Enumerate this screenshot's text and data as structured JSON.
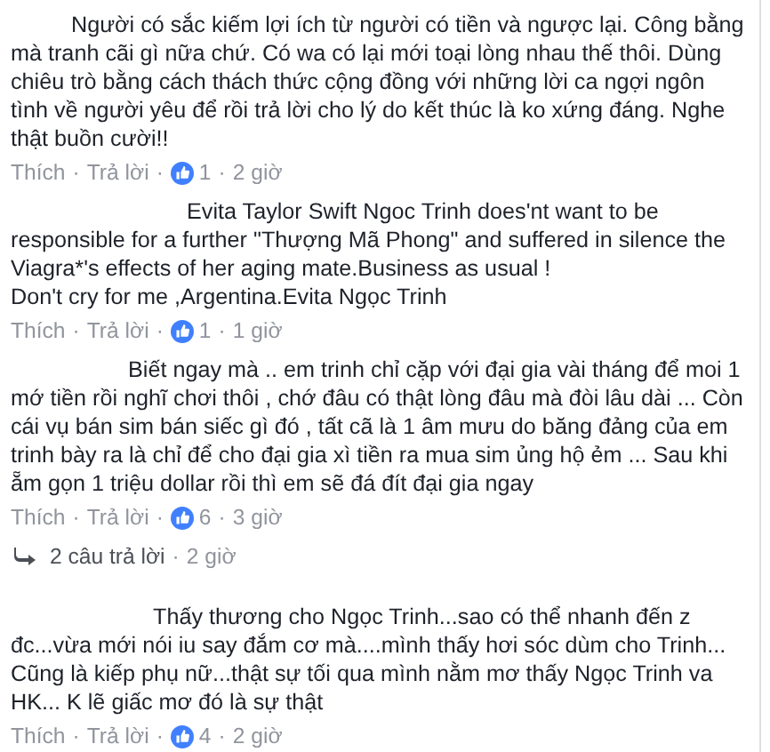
{
  "items": [
    {
      "kind": "comment",
      "text_lines": [
        "Người có sắc kiếm lợi ích từ người có tiền và ngược lại. Công bằng",
        "mà tranh cãi gì nữa chứ. Có wa có lại mới toại lòng nhau thế thôi. Dùng",
        "chiêu trò bằng cách thách thức cộng đồng với những lời ca ngợi ngôn",
        "tình về người yêu để rồi trả lời cho lý do kết thúc là ko xứng đáng. Nghe",
        "thật buồn cười!!"
      ],
      "like_label": "Thích",
      "reply_label": "Trả lời",
      "reactions": "1",
      "time": "2 giờ",
      "separators": [
        "·",
        "·",
        "·"
      ]
    },
    {
      "kind": "comment",
      "text_lines": [
        "Evita Taylor Swift Ngoc Trinh does'nt want to be",
        "responsible for a further \"Thượng Mã Phong\" and suffered in silence the",
        "Viagra*'s effects of her aging mate.Business as usual !",
        "Don't cry for me ,Argentina.Evita Ngọc Trinh"
      ],
      "like_label": "Thích",
      "reply_label": "Trả lời",
      "reactions": "1",
      "time": "1 giờ",
      "separators": [
        "·",
        "·",
        "·"
      ]
    },
    {
      "kind": "comment",
      "text_lines": [
        "Biết ngay mà .. em trinh chỉ cặp với đại gia vài tháng để moi 1",
        "mớ tiền rồi nghĩ chơi thôi , chớ đâu có thật lòng đâu mà đòi lâu dài ... Còn",
        "cái vụ bán sim bán siếc gì đó , tất cã là 1 âm mưu do băng đảng của em",
        "trinh bày ra là chỉ để cho đại gia xì tiền ra mua sim ủng hộ ẻm ... Sau khi",
        "ẵm gọn 1 triệu dollar rồi thì em sẽ đá đít đại gia ngay"
      ],
      "like_label": "Thích",
      "reply_label": "Trả lời",
      "reactions": "6",
      "time": "3 giờ",
      "separators": [
        "·",
        "·",
        "·"
      ]
    },
    {
      "kind": "replies",
      "label": "2 câu trả lời",
      "time": "2 giờ",
      "separator": "·"
    },
    {
      "kind": "comment",
      "text_lines": [
        "Thấy thương cho Ngọc Trinh...sao có thể nhanh đến z",
        "đc...vừa mới nói iu say đắm cơ mà....mình thấy hơi sóc dùm cho Trinh...",
        "Cũng là kiếp phụ nữ...thật sự tối qua mình nằm mơ thấy Ngọc Trinh va",
        "HK... K lẽ giấc mơ đó là sự thật"
      ],
      "like_label": "Thích",
      "reply_label": "Trả lời",
      "reactions": "4",
      "time": "2 giờ",
      "separators": [
        "·",
        "·",
        "·"
      ]
    }
  ]
}
